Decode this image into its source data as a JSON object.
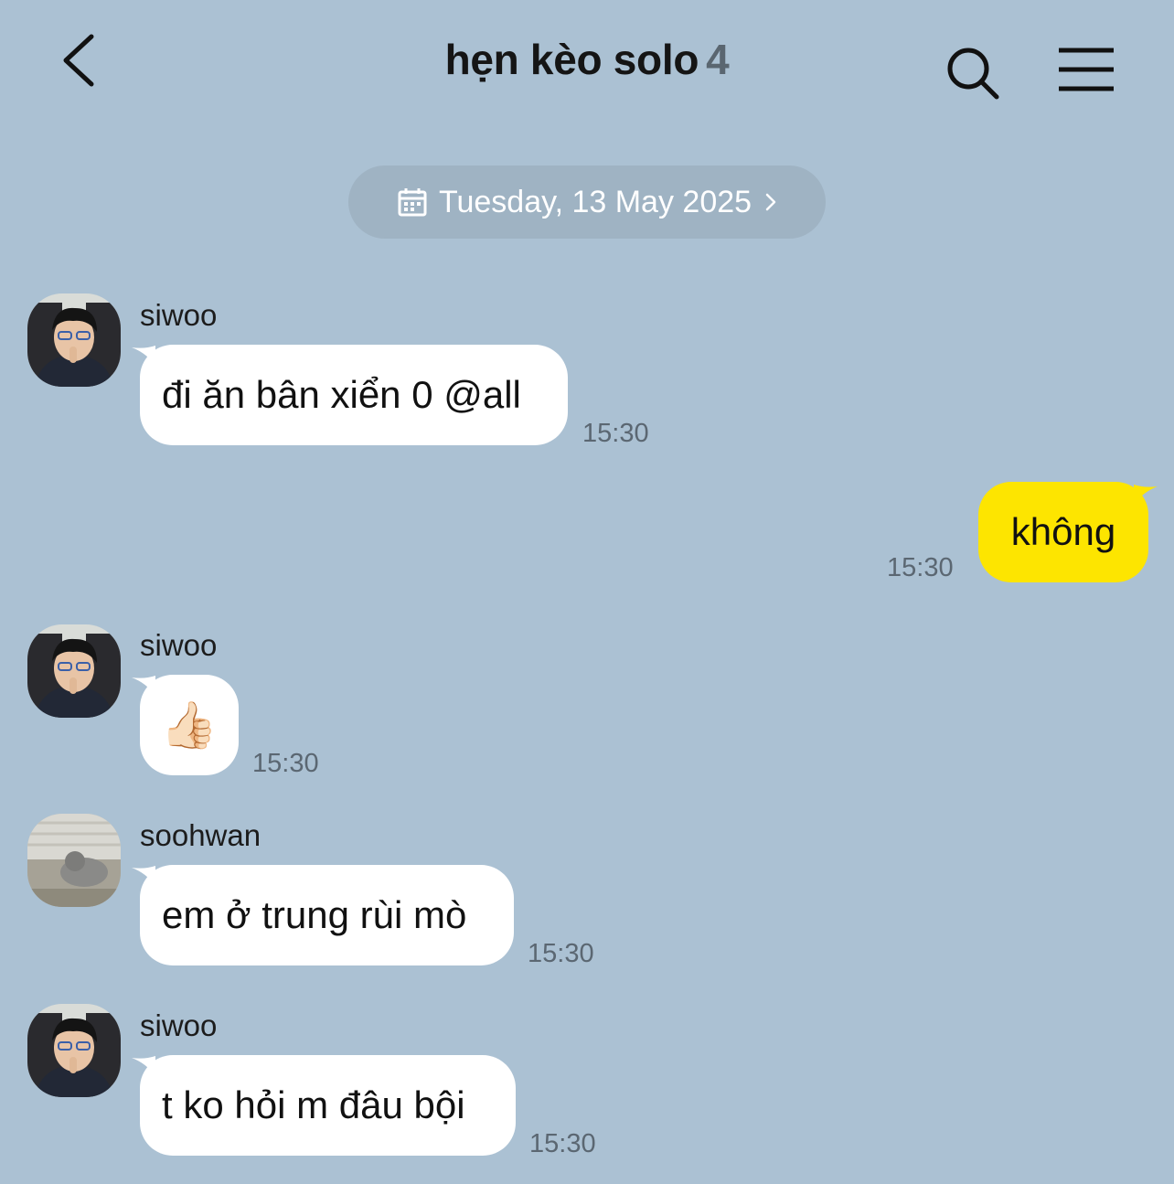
{
  "header": {
    "title": "hẹn kèo solo",
    "member_count": "4",
    "back_icon": "chevron-left-icon",
    "search_icon": "search-icon",
    "menu_icon": "hamburger-menu-icon"
  },
  "date_divider": {
    "label": "Tuesday, 13 May 2025",
    "icon": "calendar-icon"
  },
  "colors": {
    "background": "#abc1d3",
    "incoming_bubble": "#ffffff",
    "outgoing_bubble": "#fde500"
  },
  "messages": [
    {
      "sender": "siwoo",
      "text": "đi ăn bân xiển 0 @all",
      "time": "15:30",
      "direction": "incoming"
    },
    {
      "sender": "",
      "text": "không",
      "time": "15:30",
      "direction": "outgoing"
    },
    {
      "sender": "siwoo",
      "text": "👍🏻",
      "time": "15:30",
      "direction": "incoming"
    },
    {
      "sender": "soohwan",
      "text": "em ở trung rùi mò",
      "time": "15:30",
      "direction": "incoming"
    },
    {
      "sender": "siwoo",
      "text": "t ko hỏi m đâu bội",
      "time": "15:30",
      "direction": "incoming"
    }
  ]
}
